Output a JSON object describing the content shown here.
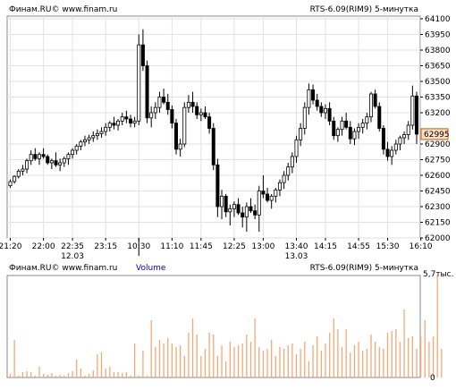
{
  "chart_data": [
    {
      "type": "candlestick",
      "header_left": "Финам.RU© www.finam.ru",
      "header_right": "RTS-6.09(RIM9) 5-минутка",
      "y_ticks": [
        64100,
        63950,
        63800,
        63650,
        63500,
        63350,
        63200,
        62900,
        62750,
        62600,
        62450,
        62300,
        62150,
        62000
      ],
      "ylim": [
        62000,
        64100
      ],
      "last_price": {
        "label": "62995",
        "value": 62995
      },
      "x_ticks": [
        {
          "label": "21:20",
          "index": 0
        },
        {
          "label": "22:00",
          "index": 8
        },
        {
          "label": "22:35",
          "index": 15
        },
        {
          "label": "23:15",
          "index": 23
        },
        {
          "label": "10:30",
          "index": 31
        },
        {
          "label": "11:10",
          "index": 39
        },
        {
          "label": "11:45",
          "index": 46
        },
        {
          "label": "12:25",
          "index": 54
        },
        {
          "label": "13:00",
          "index": 61
        },
        {
          "label": "13:40",
          "index": 69
        },
        {
          "label": "14:15",
          "index": 76
        },
        {
          "label": "14:55",
          "index": 84
        },
        {
          "label": "15:30",
          "index": 91
        },
        {
          "label": "16:10",
          "index": 99
        }
      ],
      "date_labels": [
        {
          "label": "12.03",
          "index": 15
        },
        {
          "label": "13.03",
          "index": 69
        }
      ],
      "day_separator_index": 31,
      "candles": [
        [
          62500,
          62560,
          62480,
          62540
        ],
        [
          62540,
          62600,
          62520,
          62590
        ],
        [
          62590,
          62660,
          62570,
          62640
        ],
        [
          62640,
          62700,
          62600,
          62660
        ],
        [
          62660,
          62760,
          62620,
          62740
        ],
        [
          62740,
          62840,
          62700,
          62800
        ],
        [
          62800,
          62860,
          62740,
          62760
        ],
        [
          62760,
          62820,
          62700,
          62800
        ],
        [
          62800,
          62860,
          62760,
          62780
        ],
        [
          62780,
          62800,
          62700,
          62720
        ],
        [
          62720,
          62760,
          62660,
          62740
        ],
        [
          62740,
          62820,
          62680,
          62700
        ],
        [
          62700,
          62760,
          62640,
          62720
        ],
        [
          62720,
          62780,
          62680,
          62760
        ],
        [
          62760,
          62820,
          62700,
          62800
        ],
        [
          62800,
          62860,
          62760,
          62840
        ],
        [
          62840,
          62900,
          62800,
          62880
        ],
        [
          62880,
          62940,
          62840,
          62920
        ],
        [
          62920,
          62980,
          62880,
          62940
        ],
        [
          62940,
          62990,
          62900,
          62960
        ],
        [
          62960,
          63020,
          62920,
          62980
        ],
        [
          62980,
          63040,
          62940,
          63000
        ],
        [
          63000,
          63060,
          62960,
          63020
        ],
        [
          63020,
          63100,
          62980,
          63060
        ],
        [
          63060,
          63120,
          63020,
          63100
        ],
        [
          63100,
          63160,
          63040,
          63080
        ],
        [
          63080,
          63140,
          63030,
          63120
        ],
        [
          63120,
          63200,
          63080,
          63160
        ],
        [
          63160,
          63220,
          63100,
          63140
        ],
        [
          63140,
          63180,
          63060,
          63100
        ],
        [
          63100,
          63160,
          63060,
          63120
        ],
        [
          63120,
          63950,
          63080,
          63850
        ],
        [
          63850,
          64000,
          63600,
          63650
        ],
        [
          63650,
          63700,
          63100,
          63150
        ],
        [
          63150,
          63260,
          63060,
          63200
        ],
        [
          63200,
          63300,
          63140,
          63250
        ],
        [
          63250,
          63400,
          63200,
          63350
        ],
        [
          63350,
          63430,
          63280,
          63300
        ],
        [
          63300,
          63380,
          63180,
          63230
        ],
        [
          63230,
          63270,
          63050,
          63100
        ],
        [
          63100,
          63140,
          62800,
          62850
        ],
        [
          62850,
          62950,
          62780,
          62900
        ],
        [
          62900,
          63300,
          62870,
          63250
        ],
        [
          63250,
          63370,
          63200,
          63300
        ],
        [
          63300,
          63400,
          63200,
          63260
        ],
        [
          63260,
          63300,
          63140,
          63180
        ],
        [
          63180,
          63240,
          63120,
          63200
        ],
        [
          63200,
          63260,
          63140,
          63160
        ],
        [
          63160,
          63200,
          63000,
          63050
        ],
        [
          63050,
          63100,
          62650,
          62700
        ],
        [
          62700,
          62760,
          62200,
          62300
        ],
        [
          62300,
          62460,
          62180,
          62400
        ],
        [
          62400,
          62420,
          62200,
          62250
        ],
        [
          62250,
          62320,
          62120,
          62280
        ],
        [
          62280,
          62350,
          62200,
          62320
        ],
        [
          62320,
          62380,
          62220,
          62240
        ],
        [
          62240,
          62300,
          62100,
          62200
        ],
        [
          62200,
          62340,
          62060,
          62300
        ],
        [
          62300,
          62380,
          62240,
          62260
        ],
        [
          62260,
          62320,
          62180,
          62220
        ],
        [
          62220,
          62500,
          62060,
          62450
        ],
        [
          62450,
          62600,
          62380,
          62420
        ],
        [
          62420,
          62480,
          62340,
          62360
        ],
        [
          62360,
          62420,
          62280,
          62400
        ],
        [
          62400,
          62480,
          62340,
          62460
        ],
        [
          62460,
          62560,
          62400,
          62530
        ],
        [
          62530,
          62640,
          62470,
          62600
        ],
        [
          62600,
          62720,
          62550,
          62680
        ],
        [
          62680,
          62820,
          62620,
          62780
        ],
        [
          62780,
          62980,
          62720,
          62940
        ],
        [
          62940,
          63100,
          62880,
          63050
        ],
        [
          63050,
          63300,
          62990,
          63250
        ],
        [
          63250,
          63480,
          63180,
          63420
        ],
        [
          63420,
          63470,
          63280,
          63320
        ],
        [
          63320,
          63380,
          63220,
          63260
        ],
        [
          63260,
          63300,
          63160,
          63200
        ],
        [
          63200,
          63280,
          63140,
          63240
        ],
        [
          63240,
          63300,
          63080,
          63120
        ],
        [
          63120,
          63160,
          62940,
          62980
        ],
        [
          62980,
          63060,
          62920,
          63040
        ],
        [
          63040,
          63160,
          62980,
          63120
        ],
        [
          63120,
          63200,
          63040,
          63060
        ],
        [
          63060,
          63120,
          62900,
          62950
        ],
        [
          62950,
          63050,
          62890,
          63020
        ],
        [
          63020,
          63100,
          62950,
          63060
        ],
        [
          63060,
          63140,
          63000,
          63100
        ],
        [
          63100,
          63200,
          63040,
          63160
        ],
        [
          63160,
          63400,
          63110,
          63380
        ],
        [
          63380,
          63420,
          63240,
          63260
        ],
        [
          63260,
          63300,
          63020,
          63050
        ],
        [
          63050,
          63080,
          62800,
          62850
        ],
        [
          62850,
          62920,
          62740,
          62780
        ],
        [
          62780,
          62880,
          62700,
          62840
        ],
        [
          62840,
          62940,
          62800,
          62900
        ],
        [
          62900,
          62980,
          62840,
          62960
        ],
        [
          62960,
          63020,
          62900,
          62990
        ],
        [
          62990,
          63120,
          62940,
          63080
        ],
        [
          63080,
          63460,
          63040,
          63360
        ],
        [
          63360,
          63400,
          62900,
          62995
        ]
      ]
    },
    {
      "type": "bar",
      "header_left": "Финам.RU© www.finam.ru",
      "header_center": "Volume",
      "header_right": "RTS-6.09(RIM9) 5-минутка",
      "y_ticks": [
        "5,7тыс.",
        "0"
      ],
      "ylim": [
        0,
        5700
      ],
      "values": [
        200,
        2100,
        100,
        300,
        350,
        300,
        100,
        600,
        200,
        150,
        250,
        100,
        150,
        100,
        250,
        350,
        1000,
        500,
        100,
        200,
        400,
        1300,
        1400,
        500,
        600,
        300,
        300,
        250,
        300,
        100,
        1900,
        100,
        1500,
        100,
        3200,
        1700,
        2100,
        1900,
        2200,
        1900,
        1700,
        1800,
        1200,
        2500,
        3300,
        2400,
        1200,
        1600,
        2500,
        2400,
        1200,
        1800,
        900,
        2000,
        1700,
        1800,
        1900,
        2400,
        2000,
        3300,
        1700,
        1500,
        1600,
        2100,
        1200,
        1700,
        1600,
        1800,
        1900,
        1300,
        1600,
        2000,
        900,
        1800,
        2300,
        1500,
        1900,
        2500,
        3300,
        2700,
        1700,
        2700,
        1400,
        1800,
        2000,
        1500,
        1600,
        2400,
        2000,
        1700,
        1600,
        2500,
        2600,
        2700,
        2000,
        3800,
        2200,
        2300,
        1600,
        2300,
        3200,
        2000,
        2300,
        5700,
        1600
      ]
    }
  ]
}
